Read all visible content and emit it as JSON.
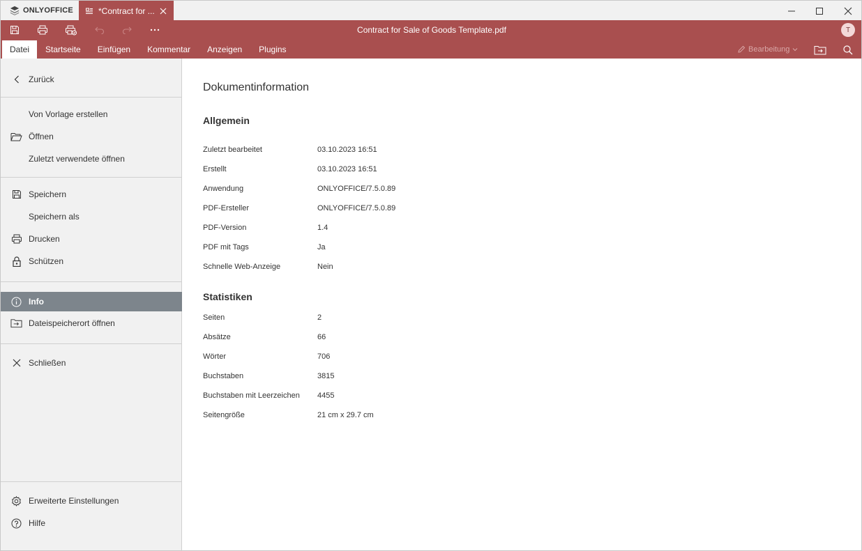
{
  "app": {
    "brand": "ONLYOFFICE"
  },
  "tab": {
    "title": "*Contract for ..."
  },
  "header": {
    "doc_title": "Contract for Sale of Goods Template.pdf",
    "avatar_initial": "T",
    "edit_mode": "Bearbeitung",
    "menu_tabs": [
      {
        "label": "Datei"
      },
      {
        "label": "Startseite"
      },
      {
        "label": "Einfügen"
      },
      {
        "label": "Kommentar"
      },
      {
        "label": "Anzeigen"
      },
      {
        "label": "Plugins"
      }
    ]
  },
  "sidebar": {
    "back": "Zurück",
    "items": [
      {
        "label": "Von Vorlage erstellen"
      },
      {
        "label": "Öffnen"
      },
      {
        "label": "Zuletzt verwendete öffnen"
      },
      {
        "label": "Speichern"
      },
      {
        "label": "Speichern als"
      },
      {
        "label": "Drucken"
      },
      {
        "label": "Schützen"
      },
      {
        "label": "Info"
      },
      {
        "label": "Dateispeicherort öffnen"
      },
      {
        "label": "Schließen"
      },
      {
        "label": "Erweiterte Einstellungen"
      },
      {
        "label": "Hilfe"
      }
    ]
  },
  "info": {
    "title": "Dokumentinformation",
    "general_title": "Allgemein",
    "general": [
      {
        "label": "Zuletzt bearbeitet",
        "value": "03.10.2023 16:51"
      },
      {
        "label": "Erstellt",
        "value": "03.10.2023 16:51"
      },
      {
        "label": "Anwendung",
        "value": "ONLYOFFICE/7.5.0.89"
      },
      {
        "label": "PDF-Ersteller",
        "value": "ONLYOFFICE/7.5.0.89"
      },
      {
        "label": "PDF-Version",
        "value": "1.4"
      },
      {
        "label": "PDF mit Tags",
        "value": "Ja"
      },
      {
        "label": "Schnelle Web-Anzeige",
        "value": "Nein"
      }
    ],
    "stats_title": "Statistiken",
    "stats": [
      {
        "label": "Seiten",
        "value": "2"
      },
      {
        "label": "Absätze",
        "value": "66"
      },
      {
        "label": "Wörter",
        "value": "706"
      },
      {
        "label": "Buchstaben",
        "value": "3815"
      },
      {
        "label": "Buchstaben mit Leerzeichen",
        "value": "4455"
      },
      {
        "label": "Seitengröße",
        "value": "21 cm x 29.7 cm"
      }
    ]
  },
  "colors": {
    "accent": "#a94f4f",
    "active_item": "#7d858c",
    "sidebar_bg": "#f1f1f1"
  }
}
